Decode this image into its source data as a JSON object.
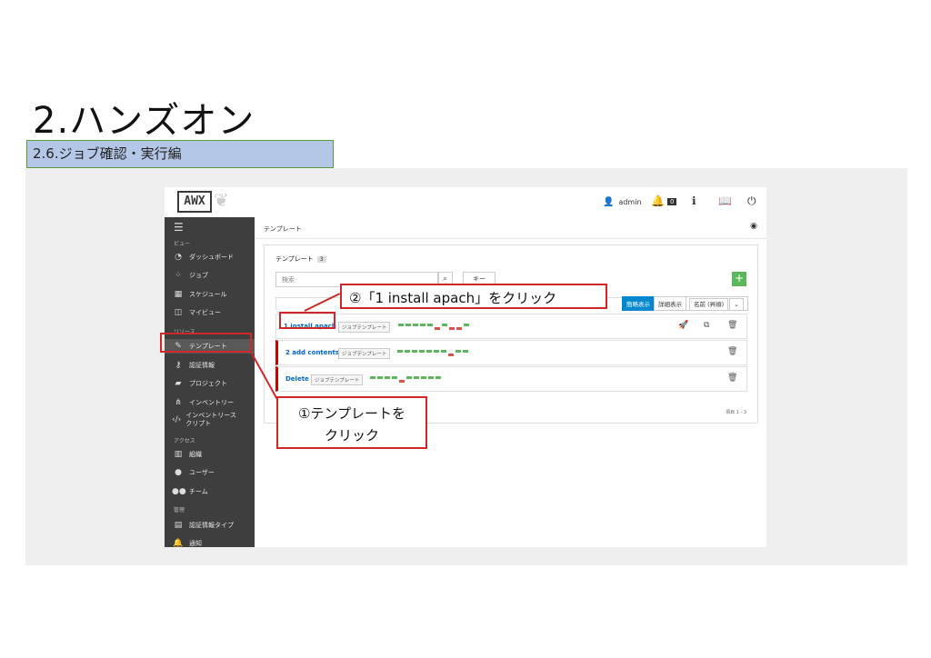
{
  "slide": {
    "title": "2.ハンズオン",
    "subtitle": "2.6.ジョブ確認・実行編"
  },
  "topbar": {
    "logo": "AWX",
    "user": "admin",
    "notification_count": "0"
  },
  "sidebar": {
    "sections": {
      "view": "ビュー",
      "resources": "リソース",
      "access": "アクセス",
      "admin": "管理"
    },
    "items": [
      {
        "label": "ダッシュボード",
        "icon": "dashboard-icon"
      },
      {
        "label": "ジョブ",
        "icon": "spinner-icon"
      },
      {
        "label": "スケジュール",
        "icon": "calendar-icon"
      },
      {
        "label": "マイビュー",
        "icon": "columns-icon"
      },
      {
        "label": "テンプレート",
        "icon": "edit-icon"
      },
      {
        "label": "認証情報",
        "icon": "key-icon"
      },
      {
        "label": "プロジェクト",
        "icon": "folder-icon"
      },
      {
        "label": "インベントリー",
        "icon": "sitemap-icon"
      },
      {
        "label": "インベントリースクリプト",
        "icon": "code-icon"
      },
      {
        "label": "組織",
        "icon": "building-icon"
      },
      {
        "label": "ユーザー",
        "icon": "user-icon"
      },
      {
        "label": "チーム",
        "icon": "users-icon"
      },
      {
        "label": "認証情報タイプ",
        "icon": "id-card-icon"
      },
      {
        "label": "通知",
        "icon": "bell-icon"
      }
    ]
  },
  "main": {
    "breadcrumb": "テンプレート",
    "panel_title": "テンプレート",
    "count": "3",
    "search_placeholder": "検索",
    "key_button": "キー",
    "views": {
      "compact": "簡略表示",
      "expanded": "詳細表示",
      "sort": "名前 (昇順)"
    },
    "templates": [
      {
        "name": "1 install apach",
        "type": "ジョブテンプレート",
        "status": [
          "ok",
          "ok",
          "ok",
          "ok",
          "ok",
          "fail",
          "ok",
          "fail",
          "fail",
          "ok"
        ]
      },
      {
        "name": "2 add contents",
        "type": "ジョブテンプレート",
        "status": [
          "ok",
          "ok",
          "ok",
          "ok",
          "ok",
          "ok",
          "ok",
          "fail",
          "ok",
          "ok"
        ]
      },
      {
        "name": "Delete",
        "type": "ジョブテンプレート",
        "status": [
          "ok",
          "ok",
          "ok",
          "ok",
          "fail",
          "ok",
          "ok",
          "ok",
          "ok",
          "ok"
        ]
      }
    ],
    "pager": "項目 1 - 3"
  },
  "callouts": {
    "click_template": "①テンプレートを\nクリック",
    "click_install": "②「1 install apach」をクリック"
  },
  "colors": {
    "ok": "#5cb85c",
    "fail": "#d9534f",
    "accent": "#0088ce",
    "callout": "#d02727"
  }
}
